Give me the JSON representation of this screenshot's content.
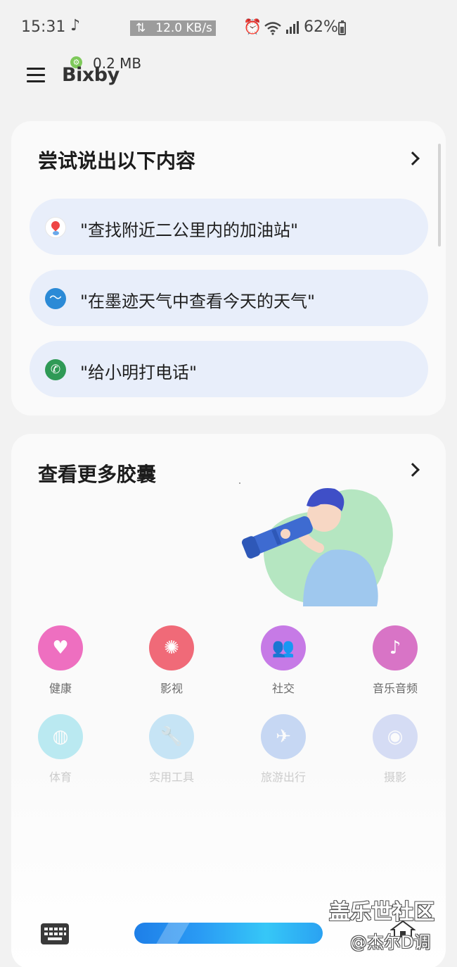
{
  "status_bar": {
    "time": "15:31",
    "net_speed": "12.0 KB/s",
    "battery": "62%",
    "icons": [
      "music-note-icon",
      "data-transfer-icon",
      "alarm-icon",
      "wifi-icon",
      "signal-icon",
      "battery-icon"
    ]
  },
  "header": {
    "app_name": "Bixby",
    "data_usage": "0.2 MB"
  },
  "try_card": {
    "title": "尝试说出以下内容",
    "suggestions": [
      {
        "text": "\"查找附近二公里内的加油站\"",
        "icon": "baidu-map-icon"
      },
      {
        "text": "\"在墨迹天气中查看今天的天气\"",
        "icon": "moji-weather-icon"
      },
      {
        "text": "\"给小明打电话\"",
        "icon": "phone-icon"
      }
    ]
  },
  "capsules_card": {
    "title": "查看更多胶囊",
    "categories": [
      {
        "label": "健康",
        "icon": "heart-pulse-icon",
        "color": "#ee6fc0"
      },
      {
        "label": "影视",
        "icon": "film-reel-icon",
        "color": "#f06a78"
      },
      {
        "label": "社交",
        "icon": "people-icon",
        "color": "#c67ae6"
      },
      {
        "label": "音乐音频",
        "icon": "music-note-icon",
        "color": "#d874c6"
      },
      {
        "label": "体育",
        "icon": "basketball-icon",
        "color": "#36c7e0"
      },
      {
        "label": "实用工具",
        "icon": "wrench-icon",
        "color": "#5ab8ec"
      },
      {
        "label": "旅游出行",
        "icon": "airplane-icon",
        "color": "#5b8fe6"
      },
      {
        "label": "摄影",
        "icon": "camera-icon",
        "color": "#8aa0e8"
      }
    ]
  },
  "bottom_bar": {
    "keyboard_icon": "keyboard-icon",
    "voice_button": "voice-input-button"
  },
  "watermark": {
    "site": "盖乐世社区",
    "user": "@杰尔D调"
  }
}
